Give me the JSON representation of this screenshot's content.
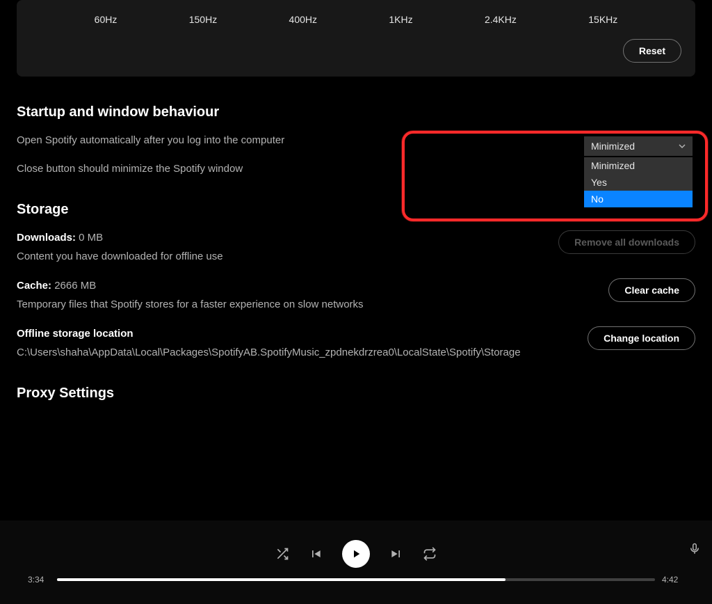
{
  "equalizer": {
    "bands": [
      "60Hz",
      "150Hz",
      "400Hz",
      "1KHz",
      "2.4KHz",
      "15KHz"
    ],
    "reset_label": "Reset"
  },
  "startup": {
    "title": "Startup and window behaviour",
    "open_auto_label": "Open Spotify automatically after you log into the computer",
    "close_min_label": "Close button should minimize the Spotify window",
    "dropdown": {
      "selected": "Minimized",
      "options": [
        "Minimized",
        "Yes",
        "No"
      ],
      "highlighted": "No"
    }
  },
  "storage": {
    "title": "Storage",
    "downloads_label": "Downloads:",
    "downloads_value": "0 MB",
    "downloads_desc": "Content you have downloaded for offline use",
    "remove_downloads_label": "Remove all downloads",
    "cache_label": "Cache:",
    "cache_value": "2666 MB",
    "cache_desc": "Temporary files that Spotify stores for a faster experience on slow networks",
    "clear_cache_label": "Clear cache",
    "offline_label": "Offline storage location",
    "offline_path": "C:\\Users\\shaha\\AppData\\Local\\Packages\\SpotifyAB.SpotifyMusic_zpdnekdrzrea0\\LocalState\\Spotify\\Storage",
    "change_location_label": "Change location"
  },
  "proxy": {
    "title": "Proxy Settings"
  },
  "player": {
    "elapsed": "3:34",
    "total": "4:42",
    "progress_percent": 75
  }
}
